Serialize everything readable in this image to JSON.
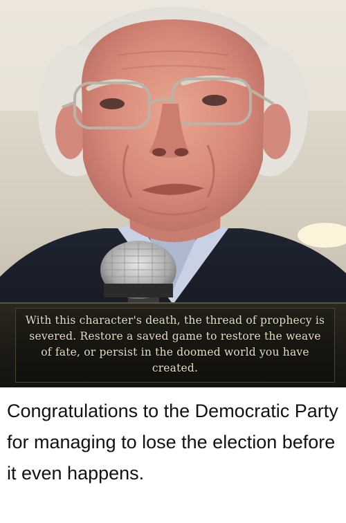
{
  "meme": {
    "caption": "With this character's death, the thread of prophecy is severed. Restore a saved game to restore the weave of fate, or persist in the doomed world you have created."
  },
  "post": {
    "text": "Congratulations to the Democratic Party for managing to lose the election before it even happens."
  },
  "colors": {
    "caption_text": "#e8dfc2",
    "caption_bg": "#1c1a14",
    "post_text": "#111111"
  }
}
